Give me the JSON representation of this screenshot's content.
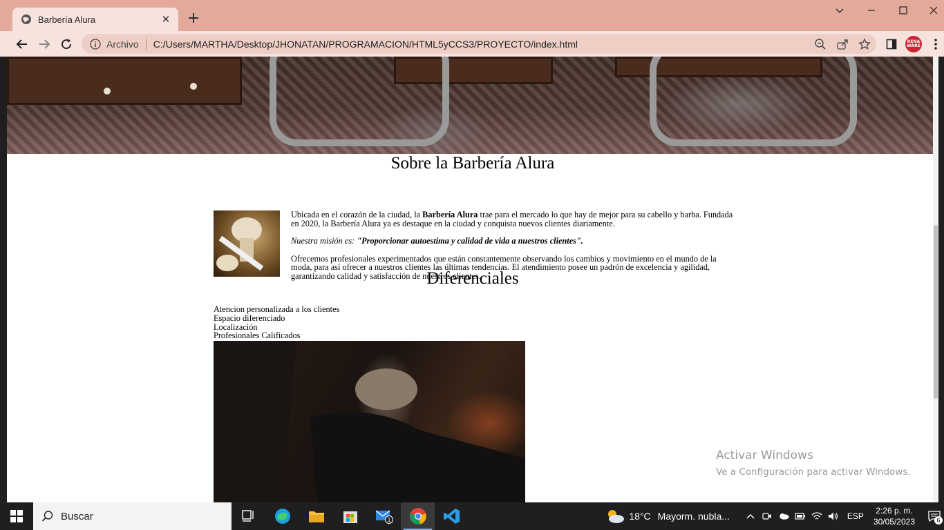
{
  "browser": {
    "tab_title": "Barbería Alura",
    "tab_close": "✕",
    "new_tab": "+",
    "omnibox_chip": "Archivo",
    "url": "C:/Users/MARTHA/Desktop/JHONATAN/PROGRAMACION/HTML5yCCS3/PROYECTO/index.html",
    "profile_label": "RENA WARE"
  },
  "page": {
    "about_title": "Sobre la Barbería Alura",
    "about_p1_a": "Ubicada en el corazón de la ciudad, la ",
    "about_p1_b": "Barbería Alura",
    "about_p1_c": " trae para el mercado lo que hay de mejor para su cabello y barba. Fundada en 2020, la Barbería Alura ya es destaque en la ciudad y conquista nuevos clientes diariamente.",
    "mission_label": "Nuestra misión es: ",
    "mission_text": "\"Proporcionar autoestima y calidad de vida a nuestros clientes\".",
    "about_p3": "Ofrecemos profesionales experimentados que están constantemente observando los cambios y movimiento en el mundo de la moda, para así ofrecer a nuestros clientes las últimas tendencias. El atendimiento posee un padrón de excelencia y agilidad, garantizando calidad y satisfacción de nuestros clientes.",
    "diff_title": "Diferenciales",
    "diff_items": [
      "Atencion personalizada a los clientes",
      "Espacio diferenciado",
      "Localización",
      "Profesionales Calificados"
    ]
  },
  "watermark": {
    "title": "Activar Windows",
    "subtitle": "Ve a Configuración para activar Windows."
  },
  "taskbar": {
    "search_placeholder": "Buscar",
    "mail_badge": "1",
    "weather_temp": "18°C",
    "weather_desc": "Mayorm. nubla...",
    "lang": "ESP",
    "time": "2:26 p. m.",
    "date": "30/05/2023",
    "notifications": "6"
  },
  "colors": {
    "tabbar": "#e3aa9b",
    "toolbar": "#f7e3dd",
    "omnibox": "#eecfc6",
    "taskbar": "#1f1f1f"
  }
}
